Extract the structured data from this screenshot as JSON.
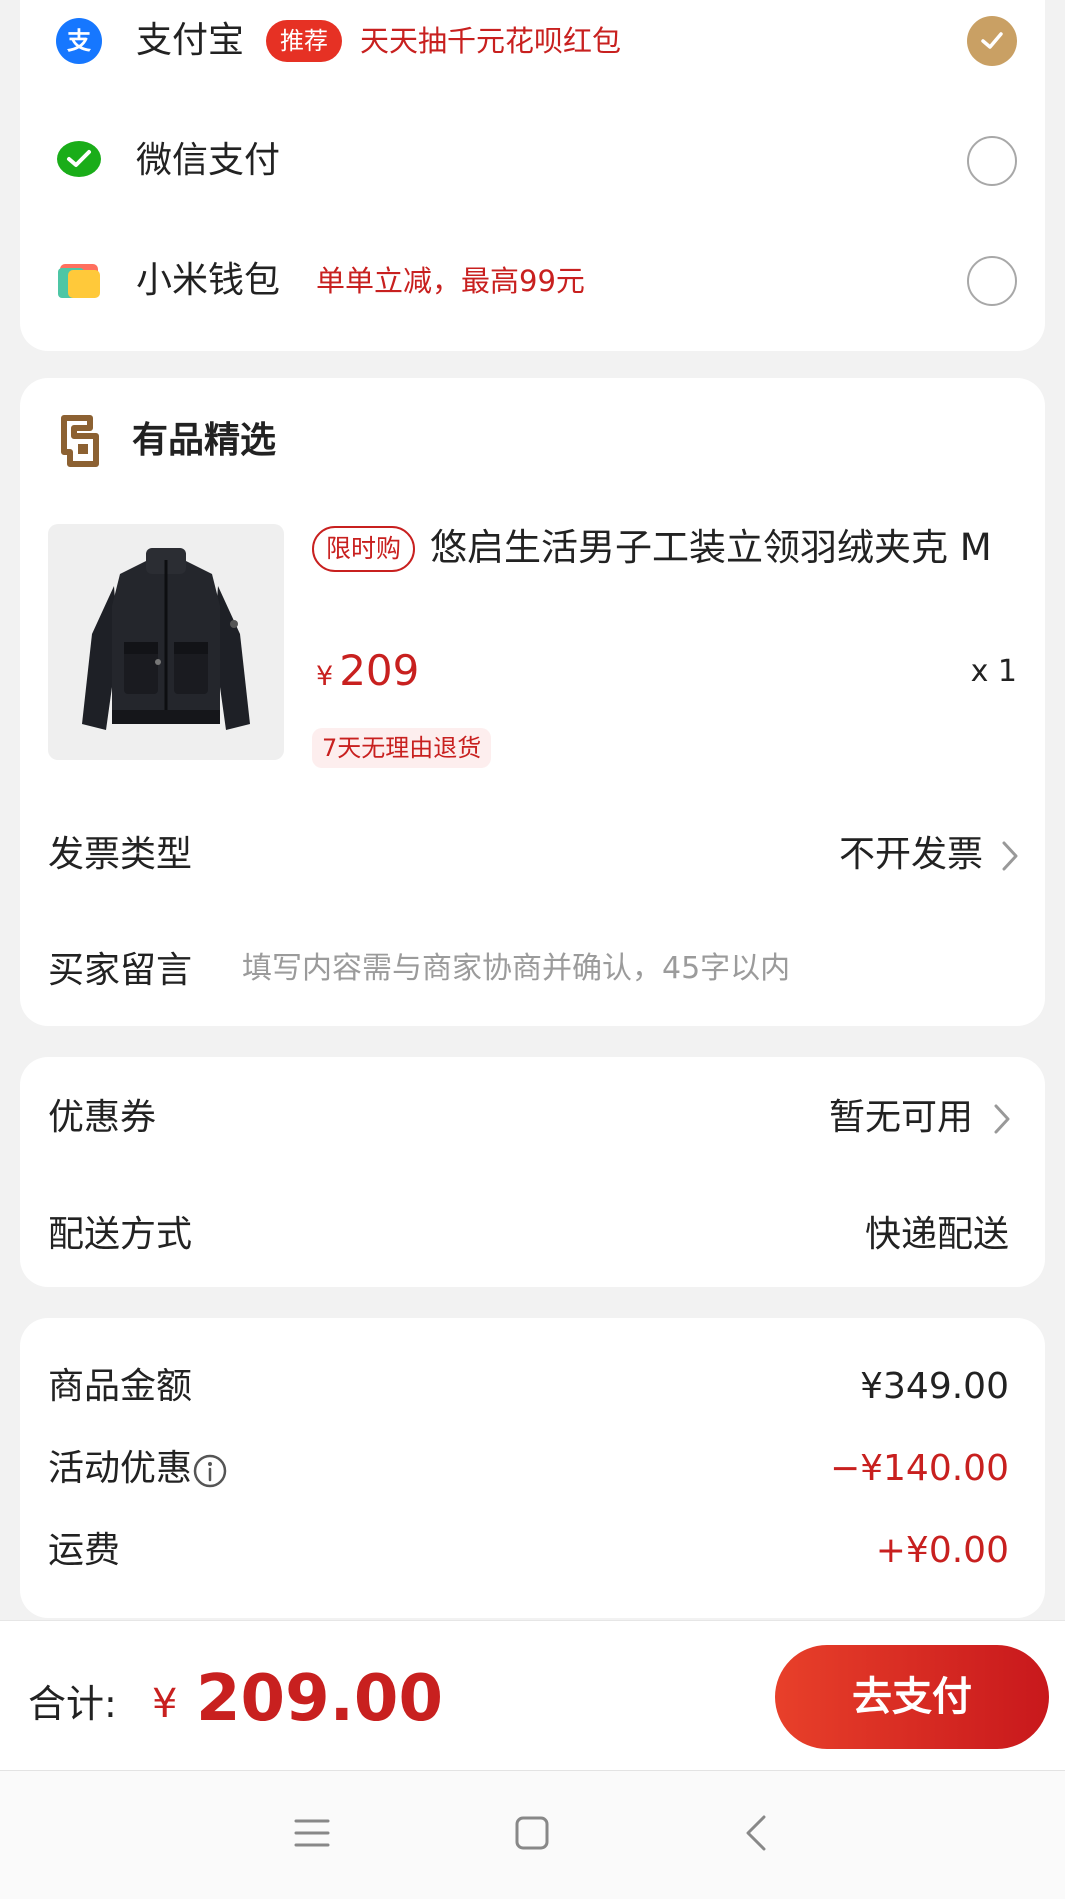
{
  "payment": {
    "methods": [
      {
        "name": "支付宝",
        "icon": "alipay-icon",
        "badge": "推荐",
        "promo": "天天抽千元花呗红包",
        "selected": true
      },
      {
        "name": "微信支付",
        "icon": "wechat-pay-icon",
        "badge": "",
        "promo": "",
        "selected": false
      },
      {
        "name": "小米钱包",
        "icon": "mi-wallet-icon",
        "badge": "",
        "promo": "单单立减，最高99元",
        "selected": false
      }
    ]
  },
  "store": {
    "name": "有品精选",
    "logo_icon": "youpin-logo-icon"
  },
  "product": {
    "tag": "限时购",
    "title": "悠启生活男子工装立领羽绒夹克 M",
    "currency": "¥",
    "price": "209",
    "quantity": "x 1",
    "return_policy": "7天无理由退货",
    "image_icon": "jacket-image"
  },
  "invoice": {
    "label": "发票类型",
    "value": "不开发票"
  },
  "message": {
    "label": "买家留言",
    "placeholder": "填写内容需与商家协商并确认，45字以内"
  },
  "coupon": {
    "label": "优惠券",
    "value": "暂无可用"
  },
  "delivery": {
    "label": "配送方式",
    "value": "快递配送"
  },
  "summary": {
    "goods_label": "商品金额",
    "goods_value": "¥349.00",
    "discount_label": "活动优惠",
    "discount_value": "−¥140.00",
    "shipping_label": "运费",
    "shipping_value": "+¥0.00"
  },
  "checkout": {
    "total_label": "合计:",
    "currency": "¥",
    "total_value": "209.00",
    "pay_button": "去支付"
  },
  "colors": {
    "accent_red": "#c8201f",
    "selected_gold": "#c9a064",
    "background": "#f2f2f2"
  },
  "nav": {
    "icons": [
      "menu-icon",
      "home-icon",
      "back-icon"
    ]
  }
}
